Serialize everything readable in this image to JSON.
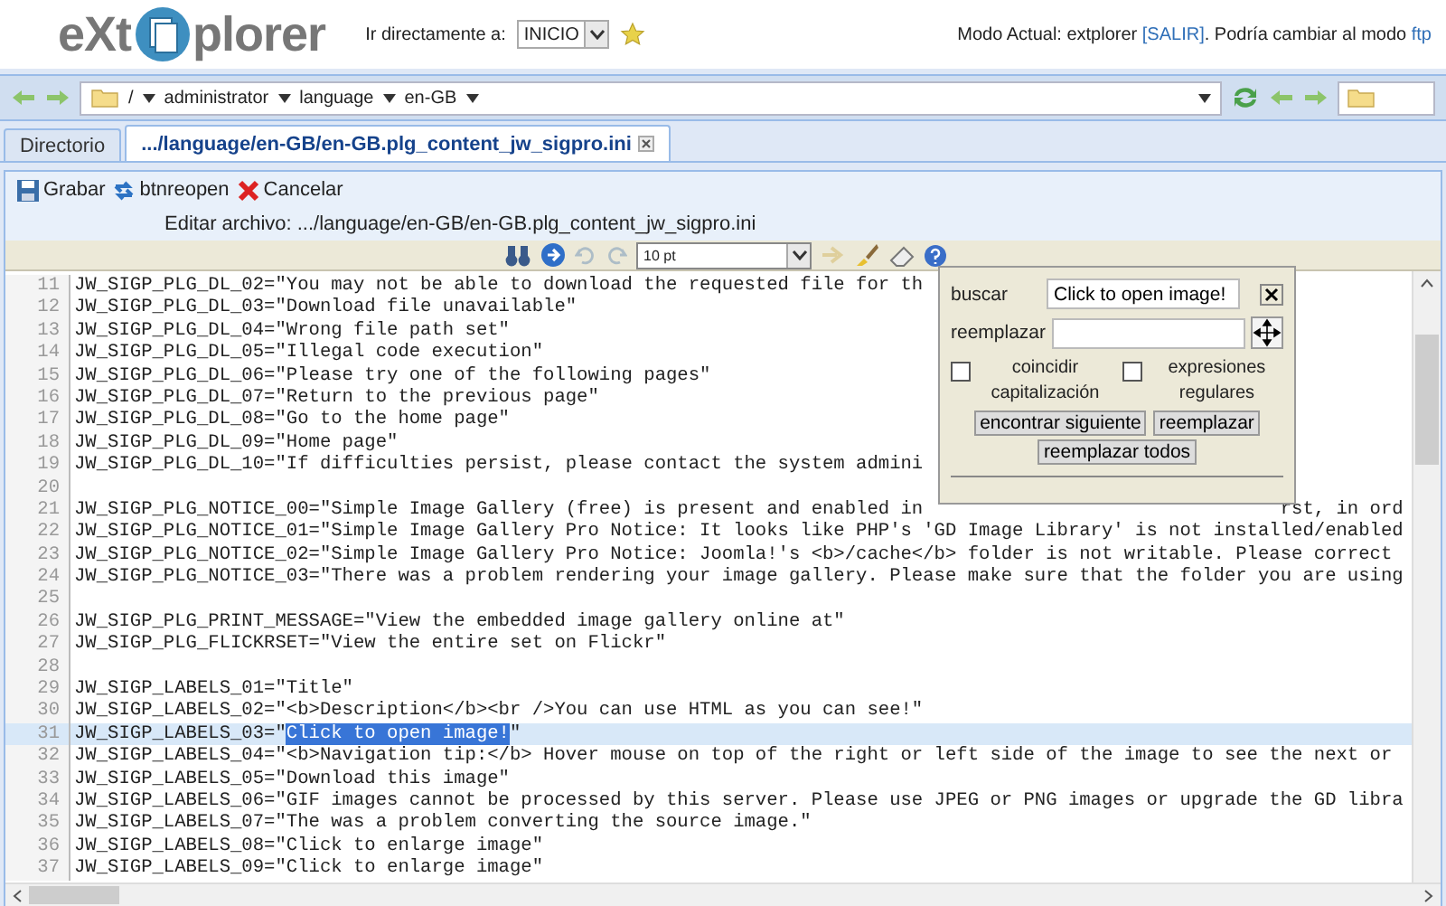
{
  "header": {
    "logo_left": "eXt",
    "logo_right": "plorer",
    "goto_label": "Ir directamente a:",
    "goto_value": "INICIO",
    "mode_text": "Modo Actual: extplorer ",
    "logout": "[SALIR]",
    "mode_middle": ". Podría cambiar al modo ",
    "mode_link": "ftp"
  },
  "path": {
    "segments": [
      "/",
      "administrator",
      "language",
      "en-GB"
    ]
  },
  "tabs": [
    {
      "label": "Directorio",
      "selected": false,
      "closable": false
    },
    {
      "label": ".../language/en-GB/en-GB.plg_content_jw_sigpro.ini",
      "selected": true,
      "closable": true
    }
  ],
  "toolbar": [
    {
      "label": "Grabar",
      "kind": "save"
    },
    {
      "label": "btnreopen",
      "kind": "reopen"
    },
    {
      "label": "Cancelar",
      "kind": "cancel"
    }
  ],
  "edit_caption": "Editar archivo: .../language/en-GB/en-GB.plg_content_jw_sigpro.ini",
  "editor_tools": [
    {
      "kind": "search",
      "disabled": false
    },
    {
      "kind": "goto",
      "disabled": false
    },
    {
      "kind": "undo",
      "disabled": true
    },
    {
      "kind": "redo",
      "disabled": true
    },
    {
      "kind": "fontsize",
      "value": "10 pt"
    },
    {
      "kind": "wrap",
      "disabled": true
    },
    {
      "kind": "highlight",
      "disabled": false
    },
    {
      "kind": "reset",
      "disabled": false
    },
    {
      "kind": "help",
      "disabled": false
    }
  ],
  "lines": [
    {
      "number": "11",
      "text": "JW_SIGP_PLG_DL_02=\"You may not be able to download the requested file for th",
      "current": false
    },
    {
      "number": "12",
      "text": "JW_SIGP_PLG_DL_03=\"Download file unavailable\"",
      "current": false
    },
    {
      "number": "13",
      "text": "JW_SIGP_PLG_DL_04=\"Wrong file path set\"",
      "current": false
    },
    {
      "number": "14",
      "text": "JW_SIGP_PLG_DL_05=\"Illegal code execution\"",
      "current": false
    },
    {
      "number": "15",
      "text": "JW_SIGP_PLG_DL_06=\"Please try one of the following pages\"",
      "current": false
    },
    {
      "number": "16",
      "text": "JW_SIGP_PLG_DL_07=\"Return to the previous page\"",
      "current": false
    },
    {
      "number": "17",
      "text": "JW_SIGP_PLG_DL_08=\"Go to the home page\"",
      "current": false
    },
    {
      "number": "18",
      "text": "JW_SIGP_PLG_DL_09=\"Home page\"",
      "current": false
    },
    {
      "number": "19",
      "text": "JW_SIGP_PLG_DL_10=\"If difficulties persist, please contact the system admini",
      "current": false
    },
    {
      "number": "20",
      "current": false
    },
    {
      "number": "21",
      "text": "JW_SIGP_PLG_NOTICE_00=\"Simple Image Gallery (free) is present and enabled in",
      "tail": "rst, in ord",
      "current": false
    },
    {
      "number": "22",
      "text": "JW_SIGP_PLG_NOTICE_01=\"Simple Image Gallery Pro Notice: It looks like PHP's 'GD Image Library' is not installed/enabled",
      "current": false
    },
    {
      "number": "23",
      "text": "JW_SIGP_PLG_NOTICE_02=\"Simple Image Gallery Pro Notice: Joomla!'s <b>/cache</b> folder is not writable. Please correct",
      "current": false
    },
    {
      "number": "24",
      "text": "JW_SIGP_PLG_NOTICE_03=\"There was a problem rendering your image gallery. Please make sure that the folder you are using",
      "current": false
    },
    {
      "number": "25",
      "current": false
    },
    {
      "number": "26",
      "text": "JW_SIGP_PLG_PRINT_MESSAGE=\"View the embedded image gallery online at\"",
      "current": false
    },
    {
      "number": "27",
      "text": "JW_SIGP_PLG_FLICKRSET=\"View the entire set on Flickr\"",
      "current": false
    },
    {
      "number": "28",
      "current": false
    },
    {
      "number": "29",
      "text": "JW_SIGP_LABELS_01=\"Title\"",
      "current": false
    },
    {
      "number": "30",
      "text": "JW_SIGP_LABELS_02=\"<b>Description</b><br />You can use HTML as you can see!\"",
      "current": false
    },
    {
      "number": "31",
      "text": "JW_SIGP_LABELS_03=\"",
      "selection": "Click to open image!",
      "after": "\"",
      "current": true
    },
    {
      "number": "32",
      "text": "JW_SIGP_LABELS_04=\"<b>Navigation tip:</b> Hover mouse on top of the right or left side of the image to see the next or",
      "current": false
    },
    {
      "number": "33",
      "text": "JW_SIGP_LABELS_05=\"Download this image\"",
      "current": false
    },
    {
      "number": "34",
      "text": "JW_SIGP_LABELS_06=\"GIF images cannot be processed by this server. Please use JPEG or PNG images or upgrade the GD libra",
      "current": false
    },
    {
      "number": "35",
      "text": "JW_SIGP_LABELS_07=\"The was a problem converting the source image.\"",
      "current": false
    },
    {
      "number": "36",
      "text": "JW_SIGP_LABELS_08=\"Click to enlarge image\"",
      "current": false
    },
    {
      "number": "37",
      "text": "JW_SIGP_LABELS_09=\"Click to enlarge image\"",
      "current": false
    }
  ],
  "find_dialog": {
    "find_label": "buscar",
    "find_value": "Click to open image!",
    "replace_label": "reemplazar",
    "options": [
      {
        "label": "coincidir capitalización",
        "checked": false
      },
      {
        "label": "expresiones regulares",
        "checked": false
      }
    ],
    "buttons": [
      "encontrar siguiente",
      "reemplazar",
      "reemplazar todos"
    ]
  }
}
